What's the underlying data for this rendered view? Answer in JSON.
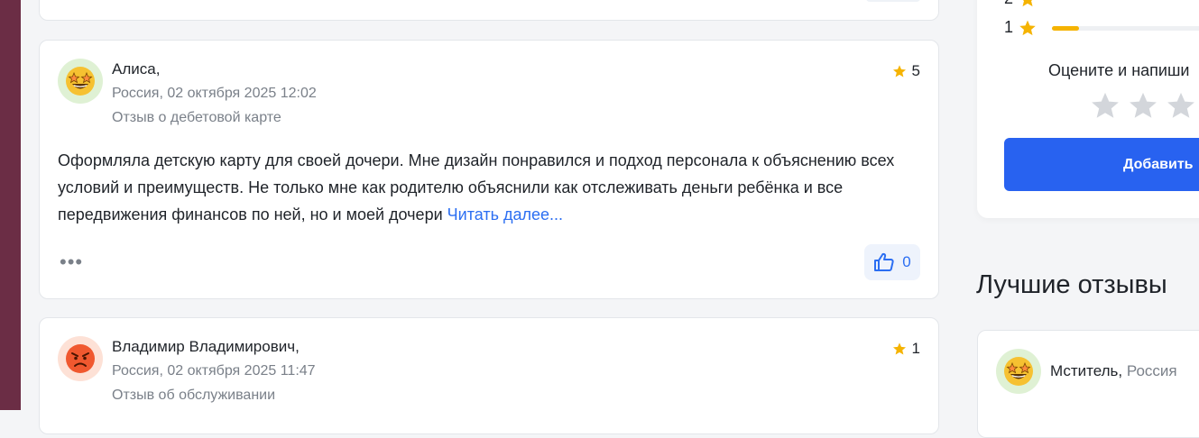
{
  "colors": {
    "accent": "#2862f0",
    "link": "#2b6ef2",
    "star": "#f5b301",
    "stripe": "#6b2d45"
  },
  "reviews": [
    {
      "author": "Алиса,",
      "meta": "Россия, 02 октября 2025 12:02",
      "subject": "Отзыв о дебетовой карте",
      "rating": "5",
      "avatar_icon": "starstruck-emoji-icon",
      "text": "Оформляла детскую карту для своей дочери. Мне дизайн понравился и подход персонала к объяснению всех условий и преимуществ. Не только мне как родителю объяснили как отслеживать деньги ребёнка и все передвижения финансов по ней, но и моей дочери ",
      "read_more": "Читать далее...",
      "more_menu": "•••",
      "likes": "0"
    },
    {
      "author": "Владимир Владимирович,",
      "meta": "Россия, 02 октября 2025 11:47",
      "subject": "Отзыв об обслуживании",
      "rating": "1",
      "avatar_icon": "angry-emoji-icon"
    }
  ],
  "sidebar": {
    "distribution": [
      {
        "stars": "2",
        "fraction": 0.0
      },
      {
        "stars": "1",
        "fraction": 0.15
      }
    ],
    "rate_prompt": "Оцените и напиши",
    "add_button": "Добавить"
  },
  "best_reviews": {
    "title": "Лучшие отзывы",
    "items": [
      {
        "author": "Мститель,",
        "country": " Россия",
        "avatar_icon": "starstruck-emoji-icon"
      }
    ]
  }
}
